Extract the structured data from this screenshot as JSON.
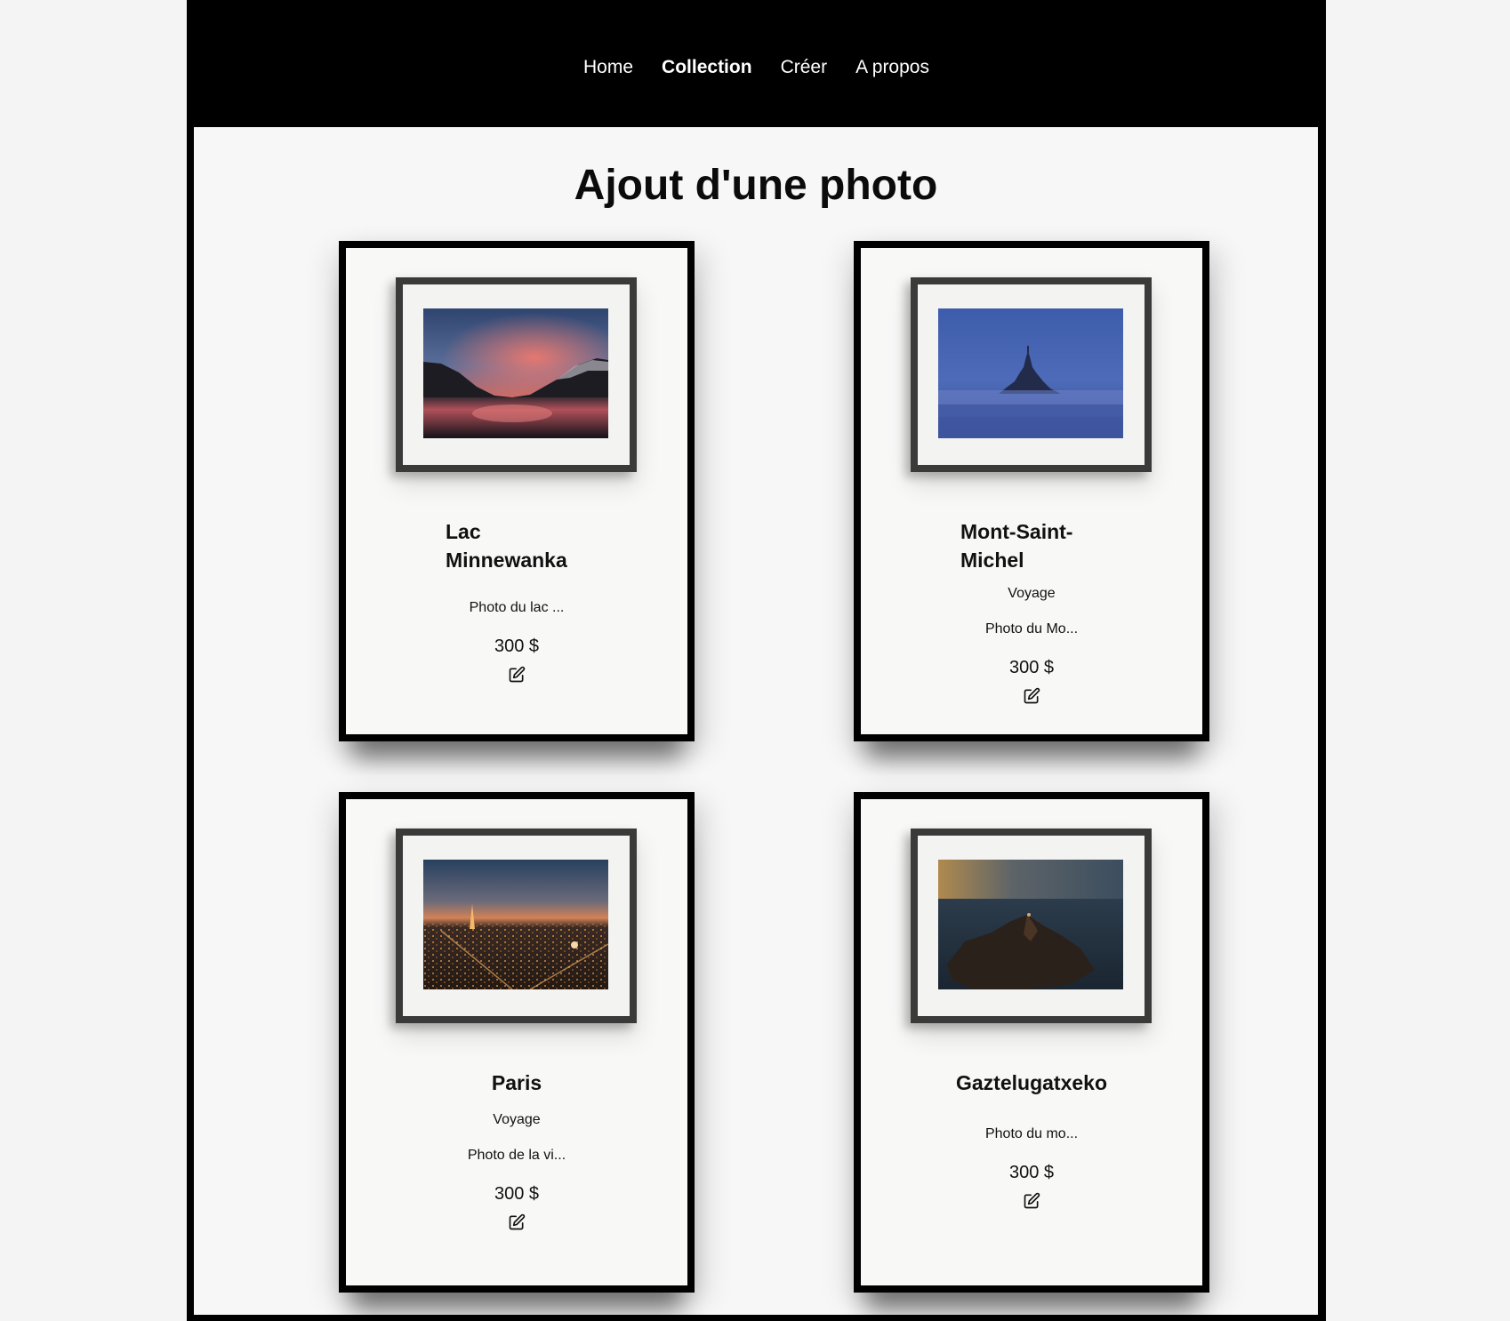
{
  "nav": {
    "items": [
      "Home",
      "Collection",
      "Créer",
      "A propos"
    ],
    "active": "Collection"
  },
  "page": {
    "title": "Ajout d'une photo"
  },
  "cards": [
    {
      "title": "Lac Minnewanka",
      "category": "",
      "description": "Photo du lac ...",
      "price": "300 $",
      "icon": "edit-icon"
    },
    {
      "title": "Mont-Saint-Michel",
      "category": "Voyage",
      "description": "Photo du Mo...",
      "price": "300 $",
      "icon": "edit-icon"
    },
    {
      "title": "Paris",
      "category": "Voyage",
      "description": "Photo de la vi...",
      "price": "300 $",
      "icon": "edit-icon"
    },
    {
      "title": "Gaztelugatxeko",
      "category": "",
      "description": "Photo du mo...",
      "price": "300 $",
      "icon": "edit-icon"
    }
  ]
}
